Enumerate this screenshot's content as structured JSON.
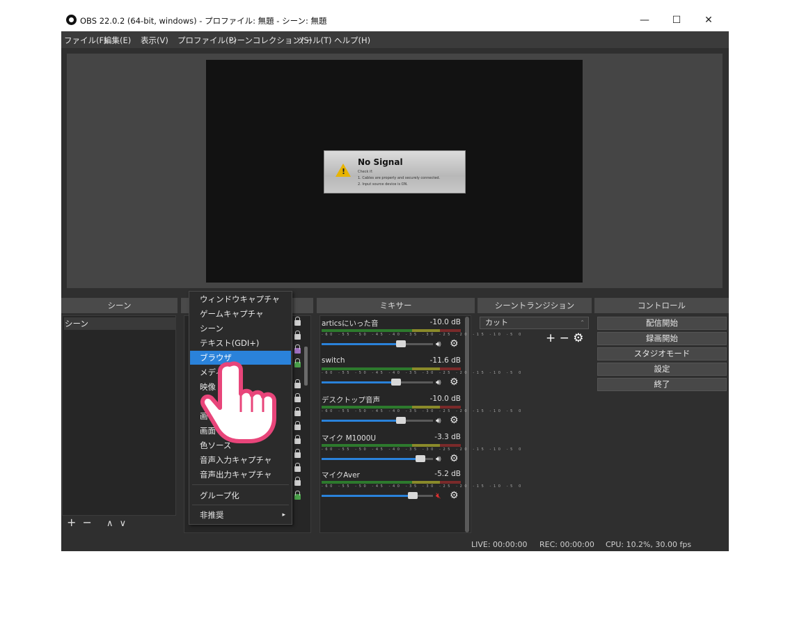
{
  "window": {
    "title": "OBS 22.0.2 (64-bit, windows) - プロファイル: 無題 - シーン: 無題",
    "minimize": "—",
    "maximize": "☐",
    "close": "✕"
  },
  "menubar": [
    "ファイル(F)",
    "編集(E)",
    "表示(V)",
    "プロファイル(P)",
    "シーンコレクション(S)",
    "ツール(T)",
    "ヘルプ(H)"
  ],
  "preview": {
    "nosignal_title": "No Signal",
    "nosignal_lines": [
      "Check if:",
      "1. Cables are properly and securely connected.",
      "2. Input source device is ON."
    ]
  },
  "docks": {
    "scenes": "シーン",
    "mixer": "ミキサー",
    "transitions": "シーントランジション",
    "controls": "コントロール"
  },
  "scenes": {
    "items": [
      "シーン"
    ],
    "add": "+",
    "remove": "−",
    "up": "∧",
    "down": "∨"
  },
  "context_menu": {
    "items": [
      "ウィンドウキャプチャ",
      "ゲームキャプチャ",
      "シーン",
      "テキスト(GDI+)",
      "ブラウザ",
      "メディアソース",
      "映像キャプチャデバイス",
      "画像",
      "画面キャプチャ",
      "色ソース",
      "音声入力キャプチャ",
      "音声出力キャプチャ"
    ],
    "visible_labels": [
      "ウィンドウキャプチャ",
      "ゲームキャプチャ",
      "シーン",
      "テキスト(GDI+)",
      "ブラウザ",
      "メディ",
      "映像",
      "画",
      "画面",
      "色ソース",
      "音声入力キャプチャ",
      "音声出力キャプチャ"
    ],
    "group": "グループ化",
    "deprecated": "非推奨",
    "selected": "ブラウザ"
  },
  "mixer": [
    {
      "name": "articsにいった音",
      "db": "-10.0 dB",
      "level": 0.71,
      "muted": false
    },
    {
      "name": "switch",
      "db": "-11.6 dB",
      "level": 0.67,
      "muted": false
    },
    {
      "name": "デスクトップ音声",
      "db": "-10.0 dB",
      "level": 0.71,
      "muted": false
    },
    {
      "name": "マイク M1000U",
      "db": "-3.3 dB",
      "level": 0.89,
      "muted": false
    },
    {
      "name": "マイクAver",
      "db": "-5.2 dB",
      "level": 0.82,
      "muted": true
    }
  ],
  "mixer_scale": "-60 -55 -50 -45 -40 -35 -30 -25 -20 -15 -10 -5 0",
  "transitions": {
    "selected": "カット",
    "tools": "+ − ⚙"
  },
  "controls": [
    "配信開始",
    "録画開始",
    "スタジオモード",
    "設定",
    "終了"
  ],
  "status": {
    "live": "LIVE: 00:00:00",
    "rec": "REC: 00:00:00",
    "cpu": "CPU: 10.2%, 30.00 fps"
  },
  "colors": {
    "accent": "#2a82da",
    "panel": "#2f2f2f",
    "cursor_outline": "#e8457a"
  }
}
